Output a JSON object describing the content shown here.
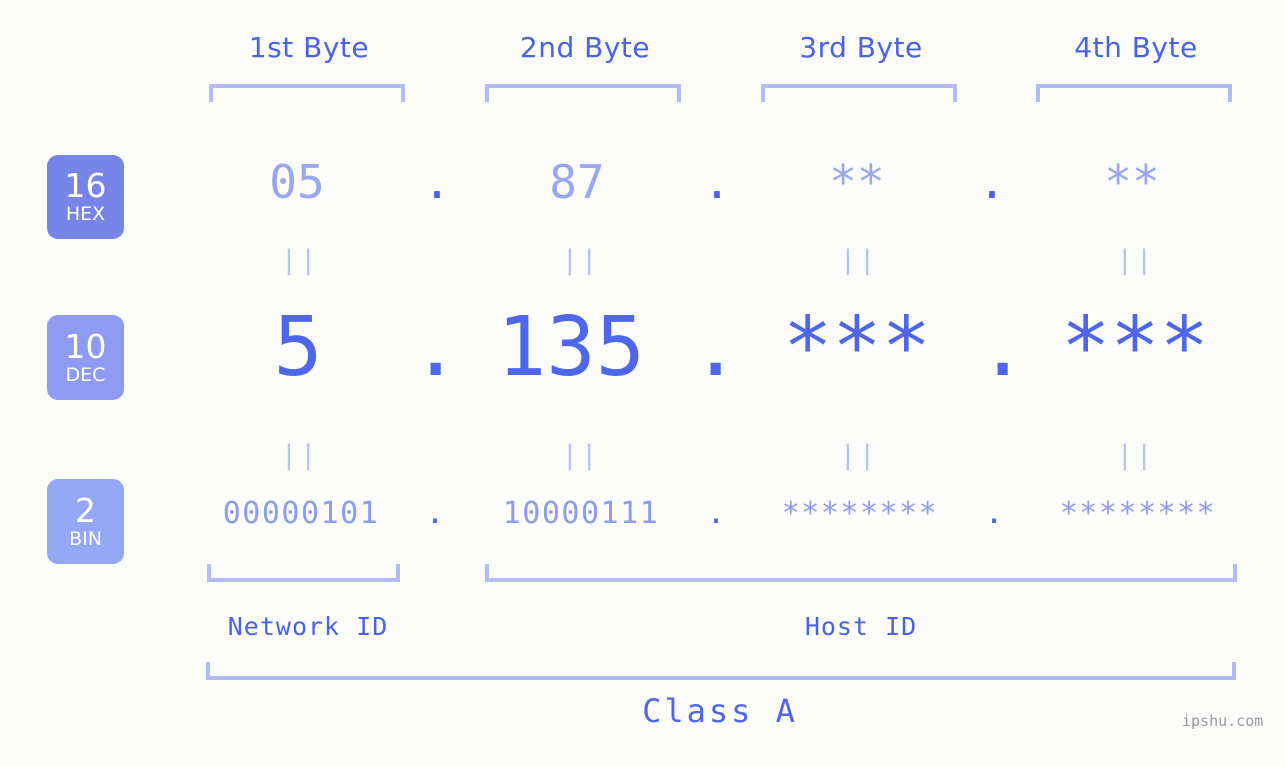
{
  "background_color": "#fcfdfa",
  "accent_color": "#4f66ea",
  "muted_accent_color": "#99a6f2",
  "bracket_color": "#b3bdf5",
  "headers": {
    "bytes": [
      {
        "label": "1st Byte"
      },
      {
        "label": "2nd Byte"
      },
      {
        "label": "3rd Byte"
      },
      {
        "label": "4th Byte"
      }
    ]
  },
  "bases": [
    {
      "number": "16",
      "name": "HEX",
      "color": "#7785e8"
    },
    {
      "number": "10",
      "name": "DEC",
      "color": "#8e9bf0"
    },
    {
      "number": "2",
      "name": "BIN",
      "color": "#94a8f6"
    }
  ],
  "rows": {
    "hex": {
      "base_number": "16",
      "base_name": "HEX",
      "values": [
        "05",
        "87",
        "**",
        "**"
      ],
      "separator": "."
    },
    "dec": {
      "base_number": "10",
      "base_name": "DEC",
      "values": [
        "5",
        "135",
        "***",
        "***"
      ],
      "separator": "."
    },
    "bin": {
      "base_number": "2",
      "base_name": "BIN",
      "values": [
        "00000101",
        "10000111",
        "********",
        "********"
      ],
      "separator": "."
    }
  },
  "equals_marks": {
    "glyph": "||",
    "count_per_row": 4
  },
  "segments": {
    "network_id": "Network ID",
    "host_id": "Host ID",
    "class": "Class A"
  },
  "watermark": "ipshu.com"
}
